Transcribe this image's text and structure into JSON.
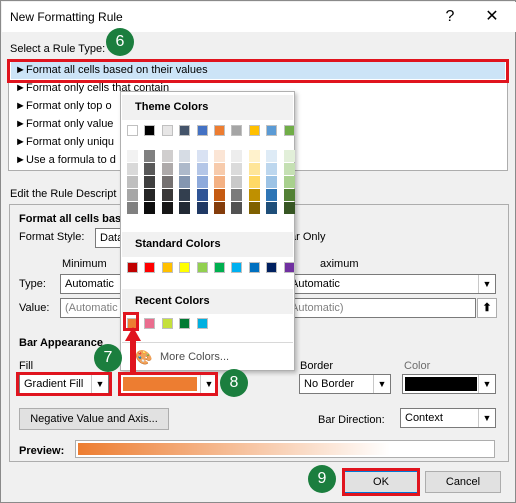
{
  "dialog": {
    "title": "New Formatting Rule",
    "help_glyph": "?",
    "close_glyph": "✕"
  },
  "rule_type": {
    "label": "Select a Rule Type:",
    "items": [
      "Format all cells based on their values",
      "Format only cells that contain",
      "Format only top o",
      "Format only value",
      "Format only uniqu",
      "Use a formula to d"
    ],
    "arrow_glyph": "►"
  },
  "rule_description": {
    "label": "Edit the Rule Descript",
    "heading": "Format all cells base",
    "format_style_label": "Format Style:",
    "format_style_value": "Data",
    "show_bar_only_label": "ar Only",
    "minimum_label": "Minimum",
    "maximum_label": "aximum",
    "type_label": "Type:",
    "type_min_value": "Automatic",
    "type_max_value": "Automatic",
    "value_label": "Value:",
    "value_min_value": "(Automatic",
    "value_max_value": "Automatic)"
  },
  "bar_appearance": {
    "label": "Bar Appearance",
    "fill_label": "Fill",
    "fill_value": "Gradient Fill",
    "border_label": "Border",
    "border_value": "No Border",
    "color_label": "Color",
    "negative_button": "Negative Value and Axis...",
    "bar_direction_label": "Bar Direction:",
    "bar_direction_value": "Context",
    "preview_label": "Preview:"
  },
  "buttons": {
    "ok": "OK",
    "cancel": "Cancel"
  },
  "color_picker": {
    "theme_colors_label": "Theme Colors",
    "standard_colors_label": "Standard Colors",
    "recent_colors_label": "Recent Colors",
    "more_colors_label": "More Colors...",
    "theme_top_row": [
      "#ffffff",
      "#000000",
      "#e7e6e6",
      "#44546a",
      "#4472c4",
      "#ed7d31",
      "#a5a5a5",
      "#ffc000",
      "#5b9bd5",
      "#70ad47"
    ],
    "theme_shades": [
      [
        "#f2f2f2",
        "#d9d9d9",
        "#bfbfbf",
        "#a6a6a6",
        "#808080"
      ],
      [
        "#808080",
        "#595959",
        "#404040",
        "#262626",
        "#0d0d0d"
      ],
      [
        "#d0cece",
        "#aeaaaa",
        "#757171",
        "#3a3838",
        "#171616"
      ],
      [
        "#d6dce4",
        "#adb9ca",
        "#8496b0",
        "#333f4f",
        "#222a35"
      ],
      [
        "#d9e2f3",
        "#b4c6e7",
        "#8eaadb",
        "#2f5496",
        "#1f3864"
      ],
      [
        "#fbe5d5",
        "#f7cbac",
        "#f4b183",
        "#c55a11",
        "#843c0b"
      ],
      [
        "#ededed",
        "#dbdbdb",
        "#c9c9c9",
        "#7b7b7b",
        "#525252"
      ],
      [
        "#fff2cc",
        "#fee599",
        "#ffd965",
        "#bf9000",
        "#7f6000"
      ],
      [
        "#deebf6",
        "#bdd7ee",
        "#9cc3e5",
        "#2e75b5",
        "#1e4e79"
      ],
      [
        "#e2efd9",
        "#c5e0b3",
        "#a8d08d",
        "#538135",
        "#375623"
      ]
    ],
    "standard": [
      "#c00000",
      "#ff0000",
      "#ffc000",
      "#ffff00",
      "#92d050",
      "#00b050",
      "#00b0f0",
      "#0070c0",
      "#002060",
      "#7030a0"
    ],
    "recent": [
      "#ed7d31",
      "#ea6d8e",
      "#c5e03c",
      "#007a33",
      "#00b0e0"
    ]
  },
  "annotations": {
    "step6": "6",
    "step7": "7",
    "step8": "8",
    "step9": "9",
    "highlight_color": "#e0141e",
    "badge_color": "#1b7e3e"
  },
  "colors": {
    "fill_color_swatch": "#ed7d31",
    "border_color_swatch": "#000000"
  }
}
